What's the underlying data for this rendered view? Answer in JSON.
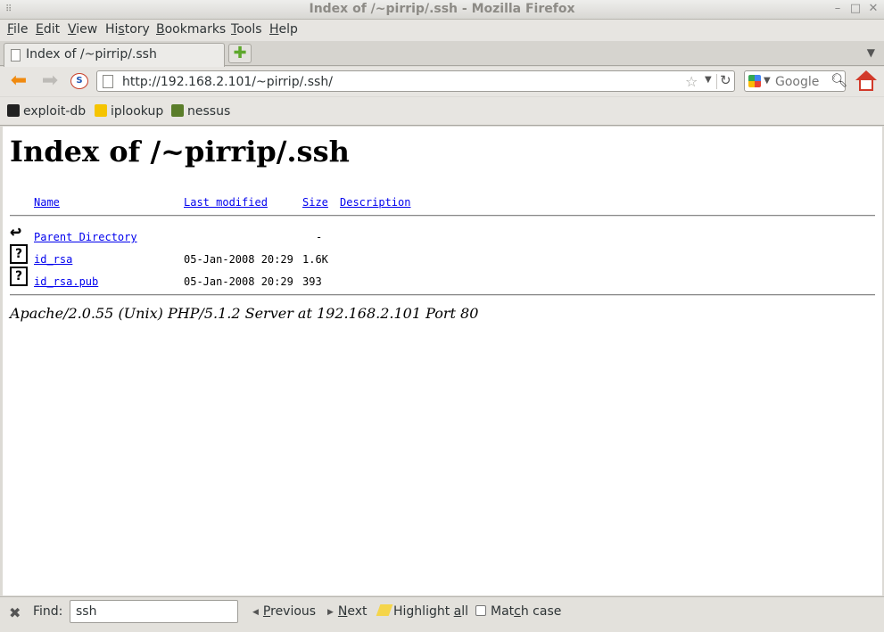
{
  "window": {
    "title": "Index of /~pirrip/.ssh - Mozilla Firefox"
  },
  "menubar": {
    "items": [
      {
        "label": "File",
        "accel": "F",
        "rest": "ile"
      },
      {
        "label": "Edit",
        "accel": "E",
        "rest": "dit"
      },
      {
        "label": "View",
        "accel": "V",
        "rest": "iew"
      },
      {
        "label": "History",
        "pre": "Hi",
        "accel": "s",
        "rest": "tory"
      },
      {
        "label": "Bookmarks",
        "accel": "B",
        "rest": "ookmarks"
      },
      {
        "label": "Tools",
        "accel": "T",
        "rest": "ools"
      },
      {
        "label": "Help",
        "accel": "H",
        "rest": "elp"
      }
    ]
  },
  "tabs": [
    {
      "label": "Index of /~pirrip/.ssh",
      "active": true
    }
  ],
  "navbar": {
    "url": "http://192.168.2.101/~pirrip/.ssh/",
    "search_engine": "Google",
    "search_placeholder": "Google"
  },
  "bookmarks": [
    {
      "label": "exploit-db",
      "icon": "exploit-db-icon",
      "color": "#222222"
    },
    {
      "label": "iplookup",
      "icon": "iplookup-icon",
      "color": "#f5c400"
    },
    {
      "label": "nessus",
      "icon": "nessus-icon",
      "color": "#5a7d2a"
    }
  ],
  "page": {
    "heading": "Index of /~pirrip/.ssh",
    "columns": {
      "name": "Name",
      "modified": "Last modified",
      "size": "Size",
      "description": "Description"
    },
    "parent": {
      "name": "Parent Directory",
      "size": "-"
    },
    "files": [
      {
        "name": "id_rsa",
        "modified": "05-Jan-2008 20:29",
        "size": "1.6K",
        "icon": "unknown-file-icon"
      },
      {
        "name": "id_rsa.pub",
        "modified": "05-Jan-2008 20:29",
        "size": "393",
        "icon": "unknown-file-icon"
      }
    ],
    "address": "Apache/2.0.55 (Unix) PHP/5.1.2 Server at 192.168.2.101 Port 80"
  },
  "findbar": {
    "label": "Find:",
    "query": "ssh",
    "previous": {
      "pre": "",
      "accel": "P",
      "rest": "revious"
    },
    "next": {
      "pre": "",
      "accel": "N",
      "rest": "ext"
    },
    "highlight": {
      "pre": "Highlight ",
      "accel": "a",
      "rest": "ll"
    },
    "matchcase": {
      "pre": "Mat",
      "accel": "c",
      "rest": "h case"
    },
    "matchcase_checked": false
  }
}
